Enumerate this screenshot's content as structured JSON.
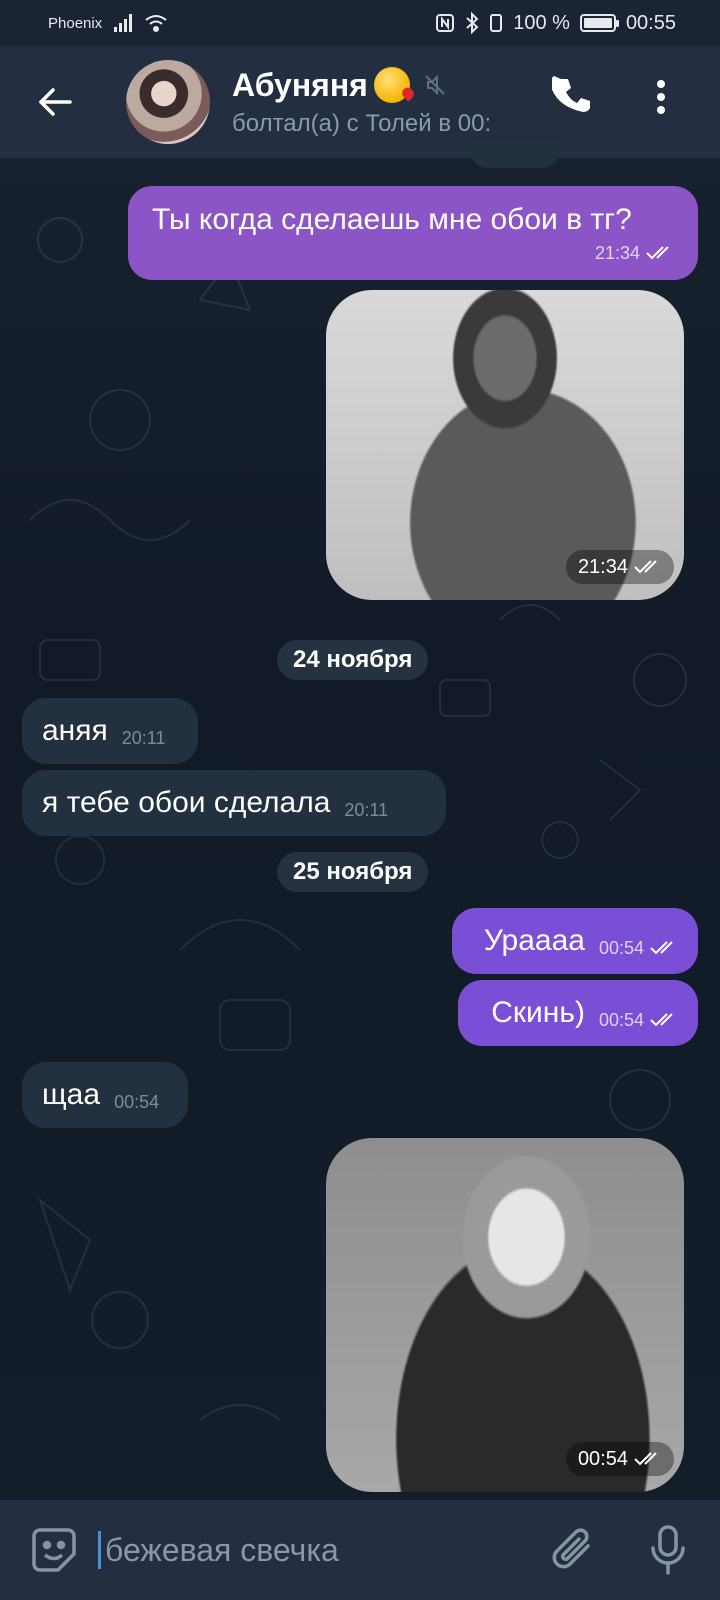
{
  "status_bar": {
    "carrier": "Phoenix",
    "battery": "100 %",
    "battery_level": 1.0,
    "time": "00:55"
  },
  "header": {
    "name": "Абуняня",
    "status": "болтал(а) с Толей в 00:"
  },
  "messages": {
    "m1": {
      "text": "Ты когда сделаешь мне обои в тг?",
      "time": "21:34"
    },
    "photo1_time": "21:34",
    "date1": "24 ноября",
    "m2": {
      "text": "аняя",
      "time": "20:11"
    },
    "m3": {
      "text": "я тебе обои сделала",
      "time": "20:11"
    },
    "date2": "25 ноября",
    "m4": {
      "text": "Ураааа",
      "time": "00:54"
    },
    "m5": {
      "text": "Скинь)",
      "time": "00:54"
    },
    "m6": {
      "text": "щаа",
      "time": "00:54"
    },
    "photo2_time": "00:54"
  },
  "input": {
    "value": "бежевая свечка"
  },
  "icons": {
    "back": "arrow-back-icon",
    "call": "phone-icon",
    "more": "more-vertical-icon",
    "mute": "mute-icon",
    "sticker": "sticker-icon",
    "attach": "paperclip-icon",
    "mic": "microphone-icon"
  },
  "colors": {
    "outgoing_bubble": "#8b55c8",
    "incoming_bubble": "#22303f",
    "header_bg": "#232f40"
  }
}
